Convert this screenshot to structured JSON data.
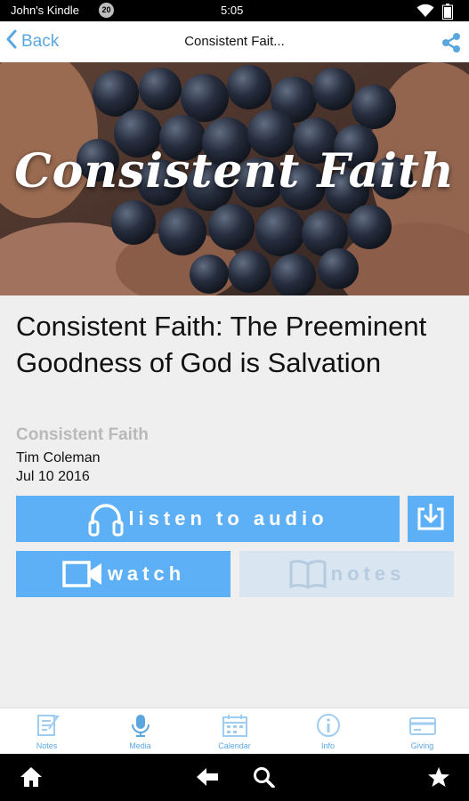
{
  "status_bar": {
    "device_name": "John's Kindle",
    "notification_count": "20",
    "time": "5:05"
  },
  "nav": {
    "back_label": "Back",
    "title": "Consistent Fait...",
    "back_icon": "chevron-left-icon",
    "share_icon": "share-icon"
  },
  "hero": {
    "overlay_text": "Consistent Faith"
  },
  "sermon": {
    "title": "Consistent Faith: The Preeminent Goodness of God is Salvation",
    "series": "Consistent Faith",
    "speaker": "Tim Coleman",
    "date": "Jul 10 2016"
  },
  "actions": {
    "listen_label": "listen to audio",
    "watch_label": "watch",
    "notes_label": "notes",
    "notes_enabled": false
  },
  "tabs": [
    {
      "label": "Notes",
      "icon": "notes-icon"
    },
    {
      "label": "Media",
      "icon": "microphone-icon"
    },
    {
      "label": "Calendar",
      "icon": "calendar-icon"
    },
    {
      "label": "Info",
      "icon": "info-icon"
    },
    {
      "label": "Giving",
      "icon": "credit-card-icon"
    }
  ],
  "colors": {
    "accent": "#5db0f5",
    "link": "#5aa7e0",
    "disabled_button": "#d9e6f2",
    "series_text": "#b9b9b9"
  }
}
